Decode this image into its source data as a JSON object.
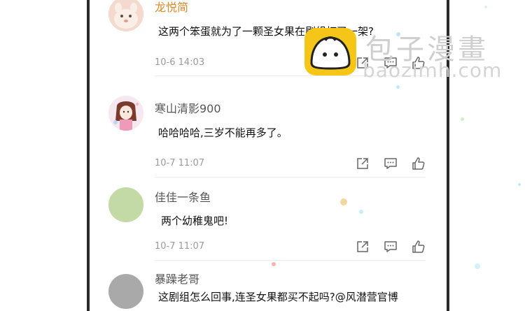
{
  "comments": [
    {
      "username": "龙悦简",
      "content": "这两个笨蛋就为了一颗圣女果在剧组打了一架?",
      "timestamp": "10-6 14:03"
    },
    {
      "username": "寒山清影900",
      "content": "哈哈哈哈,三岁不能再多了。",
      "timestamp": "10-7 11:07"
    },
    {
      "username": "佳佳一条鱼",
      "content": "两个幼稚鬼吧!",
      "timestamp": "10-7 11:07"
    },
    {
      "username": "暴躁老哥",
      "content": "这剧组怎么回事,连圣女果都买不起吗?@风潜营官博",
      "timestamp": ""
    }
  ],
  "watermark": {
    "site_name": "包子漫畫",
    "site_url": "baozimh.com"
  },
  "colors": {
    "username_highlight": "#d8892a",
    "watermark_logo": "#f5c518",
    "frame": "#2a2a2a"
  }
}
